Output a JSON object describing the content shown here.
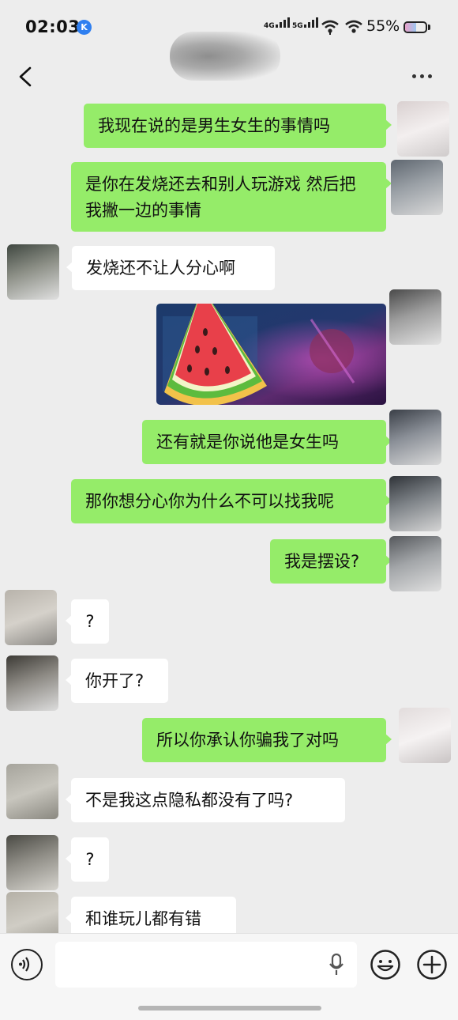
{
  "status_bar": {
    "time": "02:03",
    "app_badge": "K",
    "network_1": "4G",
    "network_2": "5G",
    "battery_percent": "55%",
    "battery_level": 0.55
  },
  "header": {
    "contact_name": "•••",
    "back_icon": "chevron-left-icon",
    "more_icon": "more-dots-icon"
  },
  "messages": [
    {
      "dir": "out",
      "text": "我现在说的是男生女生的事情吗"
    },
    {
      "dir": "out",
      "text": "是你在发烧还去和别人玩游戏 然后把我撇一边的事情"
    },
    {
      "dir": "in",
      "text": "发烧还不让人分心啊"
    },
    {
      "dir": "out",
      "type": "image",
      "content": "game-screenshot-with-watermelon-sticker"
    },
    {
      "dir": "out",
      "text": "还有就是你说他是女生吗"
    },
    {
      "dir": "out",
      "text": "那你想分心你为什么不可以找我呢"
    },
    {
      "dir": "out",
      "text": "我是摆设?"
    },
    {
      "dir": "in",
      "text": "?"
    },
    {
      "dir": "in",
      "text": "你开了?"
    },
    {
      "dir": "out",
      "text": "所以你承认你骗我了对吗"
    },
    {
      "dir": "in",
      "text": "不是我这点隐私都没有了吗?"
    },
    {
      "dir": "in",
      "text": "?"
    },
    {
      "dir": "in",
      "text": "和谁玩儿都有错"
    }
  ],
  "input_bar": {
    "value": "",
    "voice_icon": "voice-icon",
    "mic_icon": "microphone-icon",
    "emoji_icon": "emoji-icon",
    "plus_icon": "plus-icon"
  },
  "colors": {
    "background": "#ededed",
    "outgoing_bubble": "#95ec69",
    "incoming_bubble": "#ffffff"
  }
}
